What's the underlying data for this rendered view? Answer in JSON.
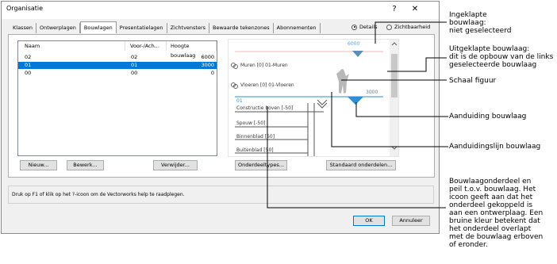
{
  "window": {
    "title": "Organisatie",
    "help_glyph": "?",
    "close_glyph": "✕"
  },
  "tabs": [
    "Klassen",
    "Ontwerplagen",
    "Bouwlagen",
    "Presentatielagen",
    "Zichtvensters",
    "Bewaarde tekenzones",
    "Abonnementen"
  ],
  "active_tab": "Bouwlagen",
  "view_mode": {
    "details_label": "Details",
    "visibility_label": "Zichtbaarheid",
    "selected": "Details"
  },
  "table": {
    "columns": [
      "Naam",
      "Voor-/Ach...",
      "Hoogte bouwlaag"
    ],
    "rows": [
      {
        "naam": "02",
        "voorach": "02",
        "hoogte": "6000",
        "selected": false
      },
      {
        "naam": "01",
        "voorach": "01",
        "hoogte": "3000",
        "selected": true
      },
      {
        "naam": "00",
        "voorach": "00",
        "hoogte": "0",
        "selected": false
      }
    ]
  },
  "preview": {
    "upper_level_value": "6000",
    "lower_level_value": "3000",
    "upper_level_name": "01",
    "components": [
      "Muren [0] 01-Muren",
      "Vloeren [0] 01-Vloeren",
      "Constructie boven [-50]",
      "Spouw [-50]",
      "Binnenblad [50]",
      "Buitenblad [50]"
    ],
    "level_color": "#2b8fd6",
    "component_color": "#a0522d"
  },
  "buttons": {
    "new": "Nieuw...",
    "edit": "Bewerk...",
    "delete": "Verwijder...",
    "components": "Onderdeeltypes...",
    "standard": "Standaard onderdelen...",
    "ok": "OK",
    "cancel": "Annuleer"
  },
  "help_text": "Druk op F1 of klik op het ?-icoon om de Vectorworks help te raadplegen.",
  "annotations": {
    "collapsed": [
      "Ingeklapte",
      "bouwlaag:",
      "niet geselecteerd"
    ],
    "expanded": [
      "Uitgeklapte bouwlaag:",
      "dit is de opbouw van de links",
      "geselecteerde bouwlaag"
    ],
    "scale_figure": "Schaal figuur",
    "level_marker": "Aanduiding bouwlaag",
    "level_line": "Aanduidingslijn bouwlaag",
    "component_note": [
      "Bouwlaagonderdeel en",
      "peil t.o.v. bouwlaag. Het",
      "icoon geeft aan dat het",
      "onderdeel gekoppeld is",
      "aan een ontwerplaag. Een",
      "bruine kleur betekent dat",
      "het onderdeel overlapt",
      "met de bouwlaag erboven",
      "of eronder."
    ]
  }
}
